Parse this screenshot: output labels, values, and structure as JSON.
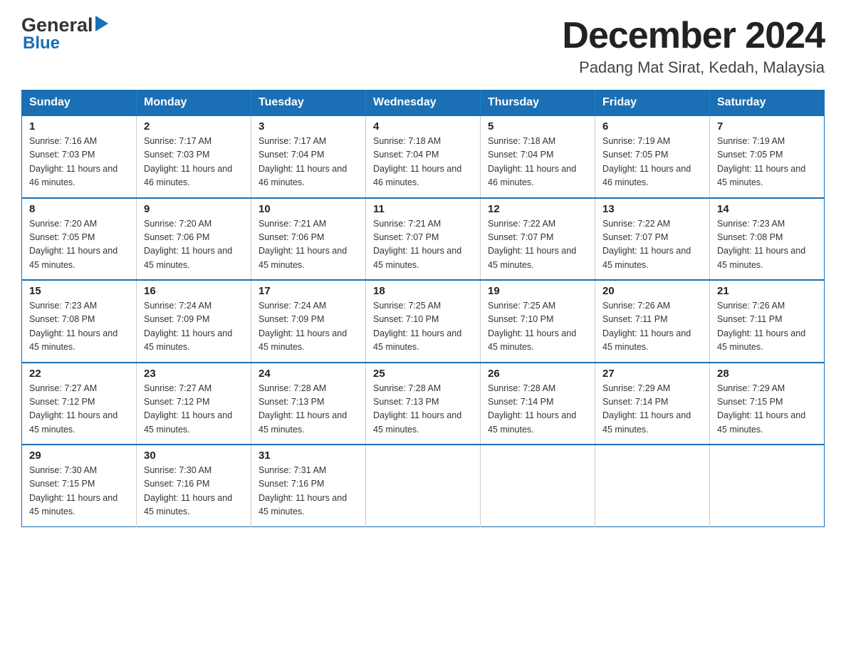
{
  "logo": {
    "general": "General",
    "blue": "Blue",
    "triangle": "▶"
  },
  "header": {
    "month_year": "December 2024",
    "location": "Padang Mat Sirat, Kedah, Malaysia"
  },
  "weekdays": [
    "Sunday",
    "Monday",
    "Tuesday",
    "Wednesday",
    "Thursday",
    "Friday",
    "Saturday"
  ],
  "weeks": [
    [
      {
        "day": "1",
        "sunrise": "7:16 AM",
        "sunset": "7:03 PM",
        "daylight": "11 hours and 46 minutes."
      },
      {
        "day": "2",
        "sunrise": "7:17 AM",
        "sunset": "7:03 PM",
        "daylight": "11 hours and 46 minutes."
      },
      {
        "day": "3",
        "sunrise": "7:17 AM",
        "sunset": "7:04 PM",
        "daylight": "11 hours and 46 minutes."
      },
      {
        "day": "4",
        "sunrise": "7:18 AM",
        "sunset": "7:04 PM",
        "daylight": "11 hours and 46 minutes."
      },
      {
        "day": "5",
        "sunrise": "7:18 AM",
        "sunset": "7:04 PM",
        "daylight": "11 hours and 46 minutes."
      },
      {
        "day": "6",
        "sunrise": "7:19 AM",
        "sunset": "7:05 PM",
        "daylight": "11 hours and 46 minutes."
      },
      {
        "day": "7",
        "sunrise": "7:19 AM",
        "sunset": "7:05 PM",
        "daylight": "11 hours and 45 minutes."
      }
    ],
    [
      {
        "day": "8",
        "sunrise": "7:20 AM",
        "sunset": "7:05 PM",
        "daylight": "11 hours and 45 minutes."
      },
      {
        "day": "9",
        "sunrise": "7:20 AM",
        "sunset": "7:06 PM",
        "daylight": "11 hours and 45 minutes."
      },
      {
        "day": "10",
        "sunrise": "7:21 AM",
        "sunset": "7:06 PM",
        "daylight": "11 hours and 45 minutes."
      },
      {
        "day": "11",
        "sunrise": "7:21 AM",
        "sunset": "7:07 PM",
        "daylight": "11 hours and 45 minutes."
      },
      {
        "day": "12",
        "sunrise": "7:22 AM",
        "sunset": "7:07 PM",
        "daylight": "11 hours and 45 minutes."
      },
      {
        "day": "13",
        "sunrise": "7:22 AM",
        "sunset": "7:07 PM",
        "daylight": "11 hours and 45 minutes."
      },
      {
        "day": "14",
        "sunrise": "7:23 AM",
        "sunset": "7:08 PM",
        "daylight": "11 hours and 45 minutes."
      }
    ],
    [
      {
        "day": "15",
        "sunrise": "7:23 AM",
        "sunset": "7:08 PM",
        "daylight": "11 hours and 45 minutes."
      },
      {
        "day": "16",
        "sunrise": "7:24 AM",
        "sunset": "7:09 PM",
        "daylight": "11 hours and 45 minutes."
      },
      {
        "day": "17",
        "sunrise": "7:24 AM",
        "sunset": "7:09 PM",
        "daylight": "11 hours and 45 minutes."
      },
      {
        "day": "18",
        "sunrise": "7:25 AM",
        "sunset": "7:10 PM",
        "daylight": "11 hours and 45 minutes."
      },
      {
        "day": "19",
        "sunrise": "7:25 AM",
        "sunset": "7:10 PM",
        "daylight": "11 hours and 45 minutes."
      },
      {
        "day": "20",
        "sunrise": "7:26 AM",
        "sunset": "7:11 PM",
        "daylight": "11 hours and 45 minutes."
      },
      {
        "day": "21",
        "sunrise": "7:26 AM",
        "sunset": "7:11 PM",
        "daylight": "11 hours and 45 minutes."
      }
    ],
    [
      {
        "day": "22",
        "sunrise": "7:27 AM",
        "sunset": "7:12 PM",
        "daylight": "11 hours and 45 minutes."
      },
      {
        "day": "23",
        "sunrise": "7:27 AM",
        "sunset": "7:12 PM",
        "daylight": "11 hours and 45 minutes."
      },
      {
        "day": "24",
        "sunrise": "7:28 AM",
        "sunset": "7:13 PM",
        "daylight": "11 hours and 45 minutes."
      },
      {
        "day": "25",
        "sunrise": "7:28 AM",
        "sunset": "7:13 PM",
        "daylight": "11 hours and 45 minutes."
      },
      {
        "day": "26",
        "sunrise": "7:28 AM",
        "sunset": "7:14 PM",
        "daylight": "11 hours and 45 minutes."
      },
      {
        "day": "27",
        "sunrise": "7:29 AM",
        "sunset": "7:14 PM",
        "daylight": "11 hours and 45 minutes."
      },
      {
        "day": "28",
        "sunrise": "7:29 AM",
        "sunset": "7:15 PM",
        "daylight": "11 hours and 45 minutes."
      }
    ],
    [
      {
        "day": "29",
        "sunrise": "7:30 AM",
        "sunset": "7:15 PM",
        "daylight": "11 hours and 45 minutes."
      },
      {
        "day": "30",
        "sunrise": "7:30 AM",
        "sunset": "7:16 PM",
        "daylight": "11 hours and 45 minutes."
      },
      {
        "day": "31",
        "sunrise": "7:31 AM",
        "sunset": "7:16 PM",
        "daylight": "11 hours and 45 minutes."
      },
      null,
      null,
      null,
      null
    ]
  ]
}
